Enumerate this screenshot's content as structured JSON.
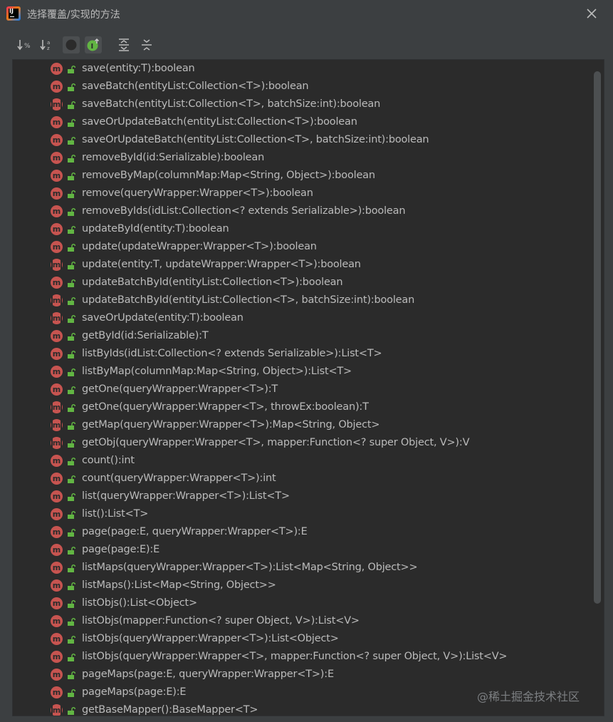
{
  "window": {
    "title": "选择覆盖/实现的方法",
    "close_icon": "close-icon"
  },
  "toolbar": {
    "buttons": [
      {
        "name": "sort-alphabetically-button",
        "icon": "sort-alpha-icon"
      },
      {
        "name": "sort-by-visibility-button",
        "icon": "sort-numeric-icon"
      },
      {
        "name": "show-fields-button",
        "icon": "circle-icon"
      },
      {
        "name": "show-interfaces-button",
        "icon": "interface-icon"
      },
      {
        "name": "expand-all-button",
        "icon": "expand-all-icon"
      },
      {
        "name": "collapse-all-button",
        "icon": "collapse-all-icon"
      }
    ]
  },
  "methods": [
    {
      "sig": "save(entity:T):boolean",
      "abstract": false
    },
    {
      "sig": "saveBatch(entityList:Collection<T>):boolean",
      "abstract": false
    },
    {
      "sig": "saveBatch(entityList:Collection<T>, batchSize:int):boolean",
      "abstract": true
    },
    {
      "sig": "saveOrUpdateBatch(entityList:Collection<T>):boolean",
      "abstract": false
    },
    {
      "sig": "saveOrUpdateBatch(entityList:Collection<T>, batchSize:int):boolean",
      "abstract": false
    },
    {
      "sig": "removeById(id:Serializable):boolean",
      "abstract": false
    },
    {
      "sig": "removeByMap(columnMap:Map<String, Object>):boolean",
      "abstract": false
    },
    {
      "sig": "remove(queryWrapper:Wrapper<T>):boolean",
      "abstract": false
    },
    {
      "sig": "removeByIds(idList:Collection<? extends Serializable>):boolean",
      "abstract": false
    },
    {
      "sig": "updateById(entity:T):boolean",
      "abstract": false
    },
    {
      "sig": "update(updateWrapper:Wrapper<T>):boolean",
      "abstract": false
    },
    {
      "sig": "update(entity:T, updateWrapper:Wrapper<T>):boolean",
      "abstract": true
    },
    {
      "sig": "updateBatchById(entityList:Collection<T>):boolean",
      "abstract": false
    },
    {
      "sig": "updateBatchById(entityList:Collection<T>, batchSize:int):boolean",
      "abstract": true
    },
    {
      "sig": "saveOrUpdate(entity:T):boolean",
      "abstract": true
    },
    {
      "sig": "getById(id:Serializable):T",
      "abstract": false
    },
    {
      "sig": "listByIds(idList:Collection<? extends Serializable>):List<T>",
      "abstract": false
    },
    {
      "sig": "listByMap(columnMap:Map<String, Object>):List<T>",
      "abstract": false
    },
    {
      "sig": "getOne(queryWrapper:Wrapper<T>):T",
      "abstract": false
    },
    {
      "sig": "getOne(queryWrapper:Wrapper<T>, throwEx:boolean):T",
      "abstract": true
    },
    {
      "sig": "getMap(queryWrapper:Wrapper<T>):Map<String, Object>",
      "abstract": true
    },
    {
      "sig": "getObj(queryWrapper:Wrapper<T>, mapper:Function<? super Object, V>):V",
      "abstract": true
    },
    {
      "sig": "count():int",
      "abstract": false
    },
    {
      "sig": "count(queryWrapper:Wrapper<T>):int",
      "abstract": false
    },
    {
      "sig": "list(queryWrapper:Wrapper<T>):List<T>",
      "abstract": false
    },
    {
      "sig": "list():List<T>",
      "abstract": false
    },
    {
      "sig": "page(page:E, queryWrapper:Wrapper<T>):E",
      "abstract": false
    },
    {
      "sig": "page(page:E):E",
      "abstract": false
    },
    {
      "sig": "listMaps(queryWrapper:Wrapper<T>):List<Map<String, Object>>",
      "abstract": false
    },
    {
      "sig": "listMaps():List<Map<String, Object>>",
      "abstract": false
    },
    {
      "sig": "listObjs():List<Object>",
      "abstract": false
    },
    {
      "sig": "listObjs(mapper:Function<? super Object, V>):List<V>",
      "abstract": false
    },
    {
      "sig": "listObjs(queryWrapper:Wrapper<T>):List<Object>",
      "abstract": false
    },
    {
      "sig": "listObjs(queryWrapper:Wrapper<T>, mapper:Function<? super Object, V>):List<V>",
      "abstract": false
    },
    {
      "sig": "pageMaps(page:E, queryWrapper:Wrapper<T>):E",
      "abstract": false
    },
    {
      "sig": "pageMaps(page:E):E",
      "abstract": false
    },
    {
      "sig": "getBaseMapper():BaseMapper<T>",
      "abstract": true
    }
  ],
  "icons": {
    "method": "method-icon",
    "public": "unlocked-icon"
  },
  "method_icon_letter": "m",
  "colors": {
    "background": "#3c3f41",
    "list_background": "#2b2b2b",
    "method_icon": "#c75450",
    "lock_icon": "#62b543",
    "text": "#bbbbbb"
  },
  "watermark": "@稀土掘金技术社区"
}
